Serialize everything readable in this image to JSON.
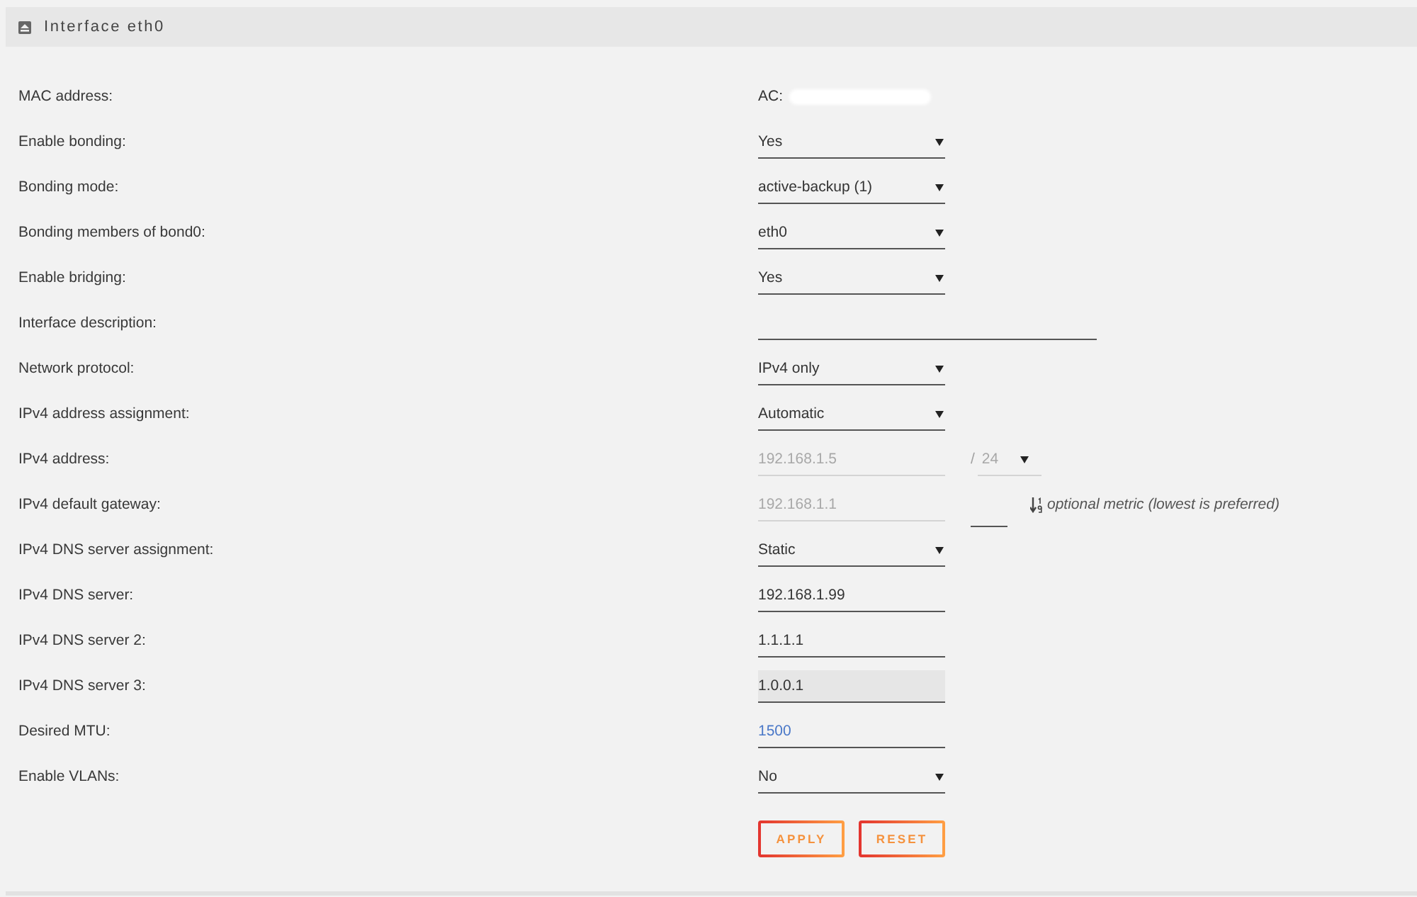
{
  "panel": {
    "title": "Interface eth0"
  },
  "rows": [
    {
      "label": "MAC address:",
      "kind": "static",
      "value": "AC:",
      "redacted": true
    },
    {
      "label": "Enable bonding:",
      "kind": "select",
      "value": "Yes"
    },
    {
      "label": "Bonding mode:",
      "kind": "select",
      "value": "active-backup (1)"
    },
    {
      "label": "Bonding members of bond0:",
      "kind": "select",
      "value": "eth0"
    },
    {
      "label": "Enable bridging:",
      "kind": "select",
      "value": "Yes"
    },
    {
      "label": "Interface description:",
      "kind": "long-input",
      "disabled": false,
      "focused": false
    },
    {
      "label": "Network protocol:",
      "kind": "select",
      "value": "IPv4 only"
    },
    {
      "label": "IPv4 address assignment:",
      "kind": "select",
      "value": "Automatic"
    },
    {
      "label": "IPv4 address:",
      "kind": "address-prefix",
      "value": "192.168.1.5",
      "disabled": true,
      "focused": false,
      "prefix": {
        "separator": "/",
        "value": "24",
        "disabled": true
      }
    },
    {
      "label": "IPv4 default gateway:",
      "kind": "address-metric",
      "value": "192.168.1.1",
      "disabled": true,
      "focused": false,
      "metric": {
        "disabled": false,
        "hint": "optional metric (lowest is preferred)"
      }
    },
    {
      "label": "IPv4 DNS server assignment:",
      "kind": "select",
      "value": "Static"
    },
    {
      "label": "IPv4 DNS server:",
      "kind": "input",
      "value": "192.168.1.99",
      "disabled": false,
      "focused": false
    },
    {
      "label": "IPv4 DNS server 2:",
      "kind": "input",
      "value": "1.1.1.1",
      "disabled": false,
      "focused": false
    },
    {
      "label": "IPv4 DNS server 3:",
      "kind": "input",
      "value": "1.0.0.1",
      "disabled": false,
      "focused": true
    },
    {
      "label": "Desired MTU:",
      "kind": "input",
      "placeholder": "1500",
      "disabled": false,
      "focused": false
    },
    {
      "label": "Enable VLANs:",
      "kind": "select",
      "value": "No"
    }
  ],
  "buttons": [
    {
      "label": "APPLY"
    },
    {
      "label": "RESET"
    }
  ]
}
